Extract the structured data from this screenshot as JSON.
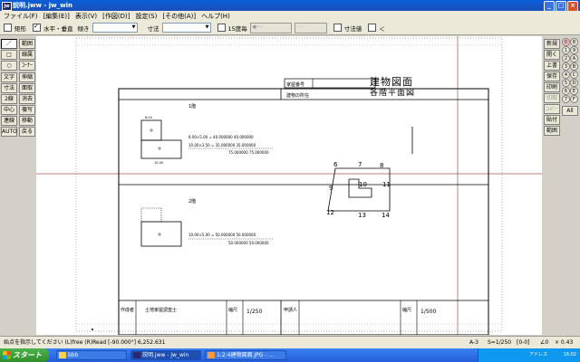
{
  "window": {
    "title": "説明.jww - jw_win",
    "app_icon": "jw"
  },
  "menu": [
    "ファイル(F)",
    "[編集(E)]",
    "表示(V)",
    "[作図(D)]",
    "設定(S)",
    "[その他(A)]",
    "ヘルプ(H)"
  ],
  "toolbar": {
    "rect_label": "矩形",
    "hv_label": "水平・垂直",
    "tilt_label": "傾き",
    "dim_label": "寸法",
    "deg15_label": "15度毎",
    "dimval_label": "寸法値",
    "angle_label": "＜"
  },
  "left_tools": [
    "範囲",
    "線属",
    "ｺｰﾅｰ",
    "伸縮",
    "面取",
    "消去",
    "複写",
    "移動",
    "戻る",
    "文字",
    "寸法",
    "2線",
    "中心線",
    "連線",
    "AUTO"
  ],
  "right_tools": [
    "新規",
    "開く",
    "上書",
    "保存",
    "印刷",
    "切取",
    "コピー",
    "貼付",
    "範囲"
  ],
  "layer_buttons": [
    "0",
    "1",
    "2",
    "3",
    "4",
    "5",
    "6",
    "7",
    "8",
    "9",
    "A",
    "B",
    "C",
    "D",
    "E",
    "F"
  ],
  "layer_all": "All",
  "drawing": {
    "title_main": "建物図面",
    "title_sub": "各階平面図",
    "house_no_label": "家屋番号",
    "location_label": "建物の所在",
    "floor1": "1階",
    "floor2": "2階",
    "author_label": "作成者",
    "author_value": "土地家屋調査士",
    "scale_label1": "縮尺",
    "scale_value1": "1/250",
    "applicant_label": "申請人",
    "scale_label2": "縮尺",
    "scale_value2": "1/500",
    "dim_small_top": "8.00",
    "dim_small_bottom": "10.00",
    "calc_row1": "8.00×5.00 = 40.000000   40.000000",
    "calc_row2": "10.00×3.50 = 35.000000   35.000000",
    "calc_total1": "75.000000   75.000000",
    "calc_row3": "10.00×5.00 = 50.000000   50.000000",
    "calc_total2": "50.000000   50.000000",
    "sketch_numbers": [
      "6",
      "7",
      "8",
      "9",
      "10",
      "11",
      "12",
      "13",
      "14"
    ]
  },
  "status": {
    "message": "始点を指示してください  (L)free  (R)Read  [-90.000°]  6,252.631",
    "paper": "A-3",
    "scale": "S=1/250",
    "layer": "[0-0]",
    "angle": "∠0",
    "zoom": "× 0.43"
  },
  "taskbar": {
    "start": "スタート",
    "tasks": [
      "bbb",
      "説明.jww - jw_win",
      "1:2:4建物図面.JPG - ..."
    ],
    "tray_text": "アドレス",
    "clock": "16:02"
  }
}
